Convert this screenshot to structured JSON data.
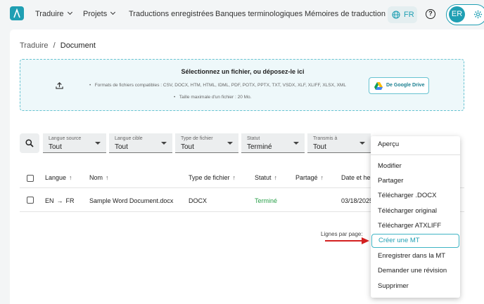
{
  "nav": {
    "items": [
      {
        "label": "Traduire",
        "dropdown": true
      },
      {
        "label": "Projets",
        "dropdown": true
      },
      {
        "label": "Traductions enregistrées",
        "dropdown": false
      },
      {
        "label": "Banques terminologiques",
        "dropdown": false
      },
      {
        "label": "Mémoires de traduction",
        "dropdown": false
      }
    ],
    "language": "FR",
    "help_glyph": "?",
    "user_initials": "ER"
  },
  "breadcrumb": {
    "root": "Traduire",
    "separator": "/",
    "current": "Document"
  },
  "upload": {
    "title": "Sélectionnez un fichier, ou déposez-le ici",
    "formats": "Formats de fichiers compatibles : CSV, DOCX, HTM, HTML, IDML, PDF, POTX, PPTX, TXT, VSDX, XLF, XLIFF, XLSX, XML",
    "max_size": "Taille maximale d'un fichier : 20 Mo.",
    "gdrive_label": "De Google Drive"
  },
  "filters": [
    {
      "label": "Langue source",
      "value": "Tout"
    },
    {
      "label": "Langue cible",
      "value": "Tout"
    },
    {
      "label": "Type de fichier",
      "value": "Tout"
    },
    {
      "label": "Statut",
      "value": "Terminé"
    },
    {
      "label": "Transmis à",
      "value": "Tout"
    }
  ],
  "table": {
    "headers": {
      "langue": "Langue",
      "nom": "Nom",
      "type": "Type de fichier",
      "statut": "Statut",
      "partage": "Partagé",
      "date": "Date et heu"
    },
    "rows": [
      {
        "source": "EN",
        "target": "FR",
        "name": "Sample Word Document.docx",
        "type": "DOCX",
        "status": "Terminé",
        "date": "03/18/2025"
      }
    ],
    "rows_per_page_label": "Lignes par page:"
  },
  "menu": {
    "items": [
      "Aperçu",
      "Modifier",
      "Partager",
      "Télécharger .DOCX",
      "Télécharger original",
      "Télécharger ATXLIFF",
      "Créer une MT",
      "Enregistrer dans la MT",
      "Demander une révision",
      "Supprimer"
    ],
    "highlighted": "Créer une MT"
  },
  "colors": {
    "accent": "#1f9fb3",
    "status_done": "#2aa04a",
    "annotation_arrow": "#d32020"
  }
}
